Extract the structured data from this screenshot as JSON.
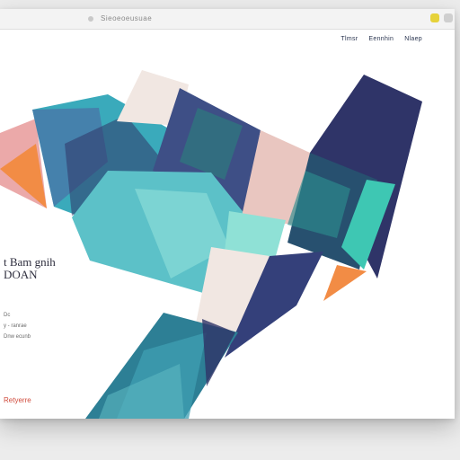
{
  "browser": {
    "url_text": "Sieoeoeusuae"
  },
  "nav": {
    "items": [
      {
        "label": "Tlmsr"
      },
      {
        "label": "Eennhin"
      },
      {
        "label": "Nlaep"
      }
    ]
  },
  "hero": {
    "headline_line1": "t Bam gnih",
    "headline_line2": "DOAN",
    "small_lines": [
      {
        "text": "Dc"
      },
      {
        "text": "y - ranrae"
      },
      {
        "text": "Dnw ecunb"
      }
    ],
    "cta_label": "Retyerre"
  },
  "colors": {
    "navy": "#2f3468",
    "teal": "#3aaabb",
    "light_teal": "#6fd3c9",
    "cream": "#f1e7e2",
    "orange": "#f28c45",
    "cta": "#d04b3c"
  }
}
